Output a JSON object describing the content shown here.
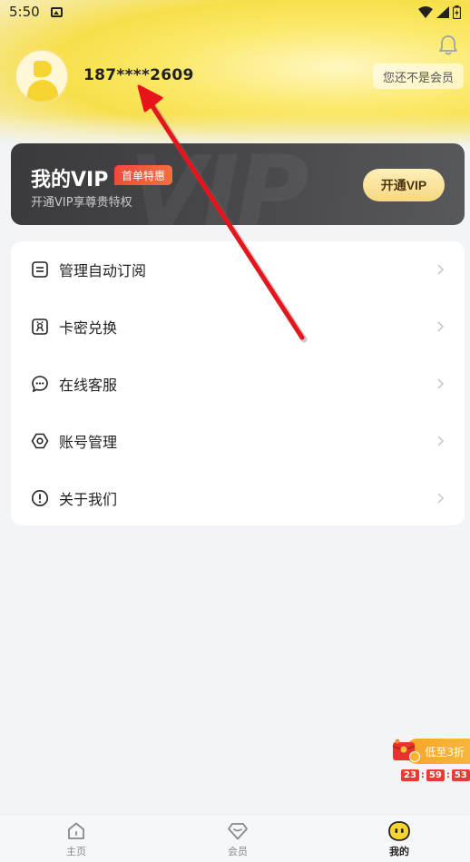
{
  "status_bar": {
    "time": "5:50"
  },
  "profile": {
    "phone": "187****2609",
    "member_status": "您还不是会员"
  },
  "vip_card": {
    "title": "我的VIP",
    "tag": "首单特惠",
    "subtitle": "开通VIP享尊贵特权",
    "button_label": "开通VIP",
    "watermark": "VIP"
  },
  "menu": {
    "items": [
      {
        "label": "管理自动订阅",
        "icon": "list-icon"
      },
      {
        "label": "卡密兑换",
        "icon": "redeem-icon"
      },
      {
        "label": "在线客服",
        "icon": "chat-icon"
      },
      {
        "label": "账号管理",
        "icon": "settings-hexagon-icon"
      },
      {
        "label": "关于我们",
        "icon": "info-icon"
      }
    ]
  },
  "promo": {
    "label": "低至3折",
    "countdown": [
      "23",
      "59",
      "53"
    ]
  },
  "tabbar": {
    "tabs": [
      {
        "label": "主页",
        "icon": "home-icon",
        "active": false
      },
      {
        "label": "会员",
        "icon": "diamond-icon",
        "active": false
      },
      {
        "label": "我的",
        "icon": "mine-face-icon",
        "active": true
      }
    ]
  },
  "colors": {
    "accent_yellow": "#f6d532",
    "vip_card_bg": "#3d3d40",
    "vip_button": "#f7d782",
    "tag_red": "#f04a3a",
    "annotation_arrow": "#e8141c"
  }
}
